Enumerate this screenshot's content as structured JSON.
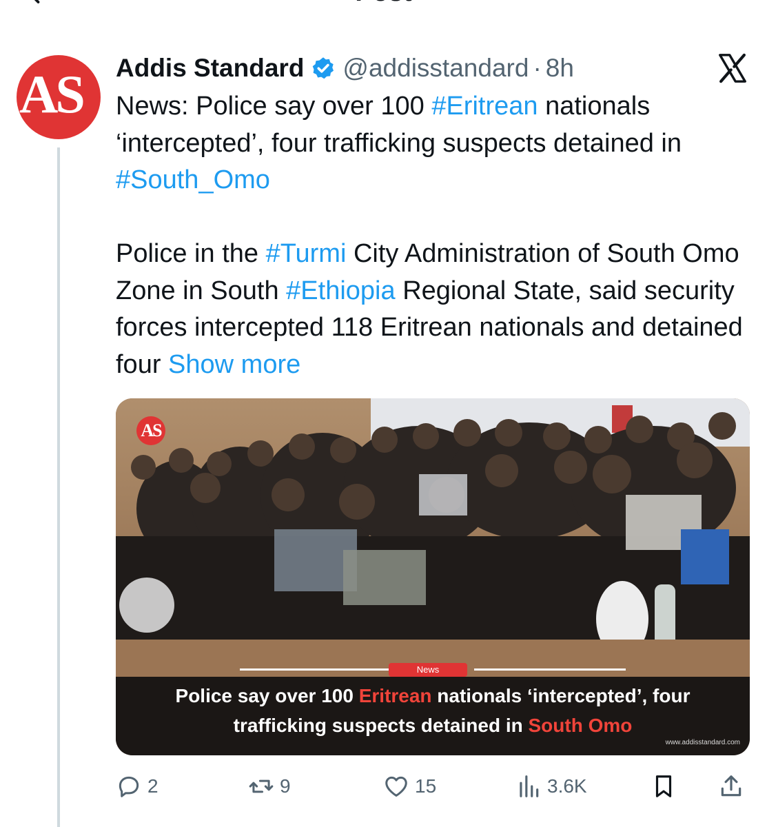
{
  "header": {
    "title": "Post"
  },
  "tweet": {
    "avatar_text": "AS",
    "author_name": "Addis Standard",
    "handle": "@addisstandard",
    "separator": "·",
    "time": "8h",
    "para1": [
      {
        "t": "News: Police say over 100 ",
        "tag": false
      },
      {
        "t": "#Eritrean",
        "tag": true
      },
      {
        "t": " nationals ‘intercepted’, four trafficking suspects detained in ",
        "tag": false
      },
      {
        "t": "#South_Omo",
        "tag": true
      }
    ],
    "para2": [
      {
        "t": "Police in the ",
        "tag": false
      },
      {
        "t": "#Turmi",
        "tag": true
      },
      {
        "t": " City Administration of South Omo Zone in South ",
        "tag": false
      },
      {
        "t": "#Ethiopia",
        "tag": true
      },
      {
        "t": " Regional State, said security forces intercepted 118 Eritrean nationals and detained four ",
        "tag": false
      }
    ],
    "show_more": "Show more"
  },
  "media": {
    "logo_text": "AS",
    "news_label": "News",
    "caption_line1": [
      {
        "t": "Police say over 100 ",
        "red": false
      },
      {
        "t": "Eritrean",
        "red": true
      },
      {
        "t": " nationals ‘intercepted’, four",
        "red": false
      }
    ],
    "caption_line2": [
      {
        "t": "trafficking suspects detained in ",
        "red": false
      },
      {
        "t": "South Omo",
        "red": true
      }
    ],
    "site_url": "www.addisstandard.com"
  },
  "actions": {
    "replies": "2",
    "reposts": "9",
    "likes": "15",
    "views": "3.6K"
  },
  "colors": {
    "link": "#1d9bf0",
    "brand_red": "#e03434",
    "muted": "#536471",
    "verified": "#1d9bf0"
  },
  "icons": [
    "back-arrow-icon",
    "verified-badge-icon",
    "x-logo-icon",
    "reply-icon",
    "repost-icon",
    "like-icon",
    "views-icon",
    "bookmark-icon",
    "share-icon"
  ]
}
